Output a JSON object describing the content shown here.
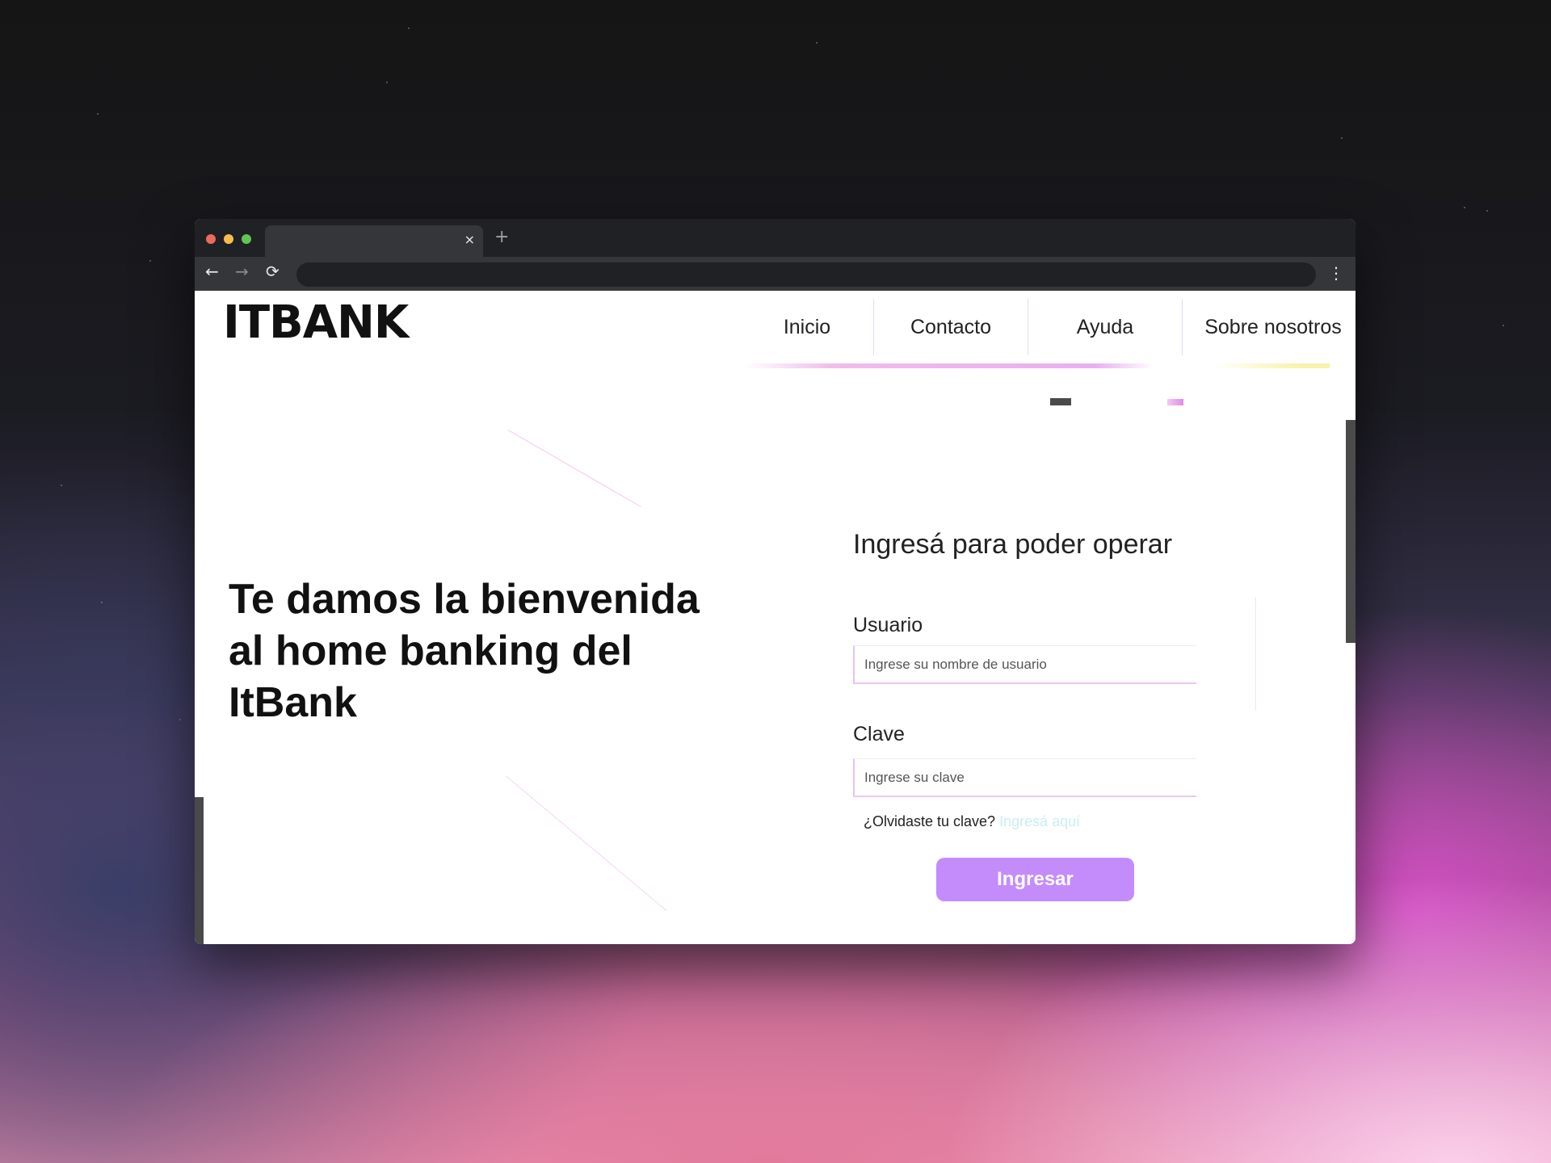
{
  "browser": {
    "tab_close_glyph": "×",
    "new_tab_glyph": "+",
    "back_glyph": "←",
    "forward_glyph": "→",
    "reload_glyph": "⟳",
    "menu_glyph": "⋮"
  },
  "header": {
    "logo": "ITBANK",
    "nav": [
      "Inicio",
      "Contacto",
      "Ayuda",
      "Sobre nosotros"
    ]
  },
  "hero": {
    "title": "Te damos la bienvenida al home banking del ItBank"
  },
  "login": {
    "title": "Ingresá para poder operar",
    "user_label": "Usuario",
    "user_placeholder": "Ingrese su nombre de usuario",
    "pass_label": "Clave",
    "pass_placeholder": "Ingrese su clave",
    "forgot_text": "¿Olvidaste tu clave?",
    "forgot_link": "Ingresá aquí",
    "submit_label": "Ingresar"
  },
  "colors": {
    "accent": "#c48cfa",
    "nav_underline": "#f0b4ea",
    "link": "#c9eef5"
  }
}
